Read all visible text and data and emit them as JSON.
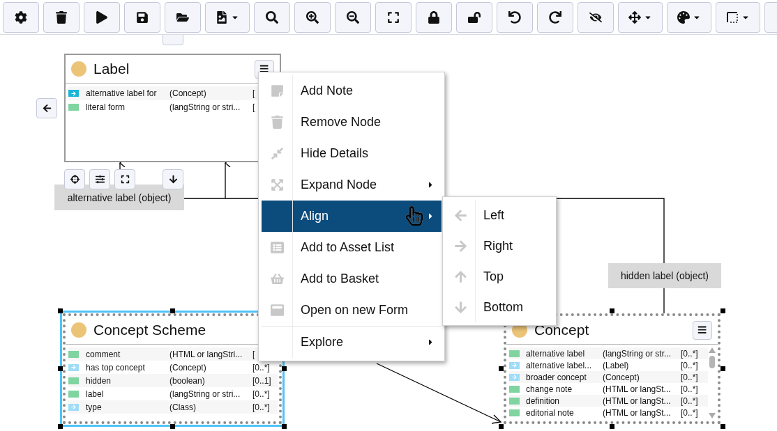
{
  "toolbar": [
    {
      "kind": "settings",
      "dropdown": false
    },
    {
      "kind": "trash",
      "dropdown": false
    },
    {
      "kind": "play",
      "dropdown": false
    },
    {
      "kind": "save",
      "dropdown": false
    },
    {
      "kind": "folder",
      "dropdown": false
    },
    {
      "kind": "image",
      "dropdown": true
    },
    {
      "kind": "search",
      "dropdown": false
    },
    {
      "kind": "zoom-in",
      "dropdown": false
    },
    {
      "kind": "zoom-out",
      "dropdown": false
    },
    {
      "kind": "fullscreen",
      "dropdown": false
    },
    {
      "kind": "lock",
      "dropdown": false
    },
    {
      "kind": "unlock",
      "dropdown": false
    },
    {
      "kind": "undo",
      "dropdown": false
    },
    {
      "kind": "redo",
      "dropdown": false
    },
    {
      "kind": "eye-slash",
      "dropdown": false
    },
    {
      "kind": "move",
      "dropdown": true
    },
    {
      "kind": "palette",
      "dropdown": true
    },
    {
      "kind": "select",
      "dropdown": true
    },
    {
      "kind": "partial",
      "dropdown": false
    }
  ],
  "node_tools": [
    {
      "kind": "partial"
    },
    {
      "kind": "arrow-left"
    },
    {
      "kind": "crosshair"
    },
    {
      "kind": "sliders"
    },
    {
      "kind": "fullscreen"
    },
    {
      "kind": "arrow-down"
    }
  ],
  "nodes": [
    {
      "title": "Label",
      "selected": false,
      "focused": false,
      "menu_button": true,
      "rows": [
        {
          "kind": "link",
          "color": "#1ab5d6",
          "name": "alternative label for",
          "type": "(Concept)",
          "multiplicity": "["
        },
        {
          "kind": "literal",
          "color": "#7fd4a0",
          "name": "literal form",
          "type": "(langString or stri...",
          "multiplicity": "["
        }
      ]
    },
    {
      "title": "Concept Scheme",
      "selected": true,
      "focused": true,
      "menu_button": false,
      "rows": [
        {
          "kind": "literal",
          "color": "#7fd4a0",
          "name": "comment",
          "type": "(HTML or langStri...",
          "multiplicity": "["
        },
        {
          "kind": "link",
          "color": "#9fdcf8",
          "name": "has top concept",
          "type": "(Concept)",
          "multiplicity": "[0..*]"
        },
        {
          "kind": "literal",
          "color": "#7fd4a0",
          "name": "hidden",
          "type": "(boolean)",
          "multiplicity": "[0..1]"
        },
        {
          "kind": "literal",
          "color": "#7fd4a0",
          "name": "label",
          "type": "(langString or stri...",
          "multiplicity": "[0..*]"
        },
        {
          "kind": "link",
          "color": "#9fdcf8",
          "name": "type",
          "type": "(Class)",
          "multiplicity": "[0..*]"
        }
      ]
    },
    {
      "title": "Concept",
      "selected": true,
      "focused": false,
      "menu_button": true,
      "rows": [
        {
          "kind": "literal",
          "color": "#7fd4a0",
          "name": "alternative label",
          "type": "(langString or str...",
          "multiplicity": "[0..*]"
        },
        {
          "kind": "link",
          "color": "#9fdcf8",
          "name": "alternative label...",
          "type": "(Label)",
          "multiplicity": "[0..*]"
        },
        {
          "kind": "link",
          "color": "#9fdcf8",
          "name": "broader concept",
          "type": "(Concept)",
          "multiplicity": "[0..*]"
        },
        {
          "kind": "literal",
          "color": "#7fd4a0",
          "name": "change note",
          "type": "(HTML or langSt...",
          "multiplicity": "[0..*]"
        },
        {
          "kind": "literal",
          "color": "#7fd4a0",
          "name": "definition",
          "type": "(HTML or langSt...",
          "multiplicity": "[0..*]"
        },
        {
          "kind": "literal",
          "color": "#7fd4a0",
          "name": "editorial note",
          "type": "(HTML or langSt...",
          "multiplicity": "[0..*]"
        }
      ]
    }
  ],
  "edge_labels": [
    "alternative label (object)",
    "hidden label (object)"
  ],
  "context_menu": [
    {
      "label": "Add Note",
      "kind": "note",
      "submenu": false,
      "selected": false,
      "divider_before": false
    },
    {
      "label": "Remove Node",
      "kind": "trash",
      "submenu": false,
      "selected": false,
      "divider_before": false
    },
    {
      "label": "Hide Details",
      "kind": "compress",
      "submenu": false,
      "selected": false,
      "divider_before": false
    },
    {
      "label": "Expand Node",
      "kind": "expand",
      "submenu": true,
      "selected": false,
      "divider_before": false
    },
    {
      "label": "Align",
      "kind": "plain",
      "submenu": true,
      "selected": true,
      "divider_before": false
    },
    {
      "label": "Add to Asset List",
      "kind": "list",
      "submenu": false,
      "selected": false,
      "divider_before": false
    },
    {
      "label": "Add to Basket",
      "kind": "basket",
      "submenu": false,
      "selected": false,
      "divider_before": false
    },
    {
      "label": "Open on new Form",
      "kind": "window",
      "submenu": false,
      "selected": false,
      "divider_before": false
    },
    {
      "label": "Explore",
      "kind": "plain",
      "submenu": true,
      "selected": false,
      "divider_before": true
    }
  ],
  "submenu": [
    {
      "label": "Left",
      "kind": "left"
    },
    {
      "label": "Right",
      "kind": "right"
    },
    {
      "label": "Top",
      "kind": "up"
    },
    {
      "label": "Bottom",
      "kind": "down"
    }
  ]
}
